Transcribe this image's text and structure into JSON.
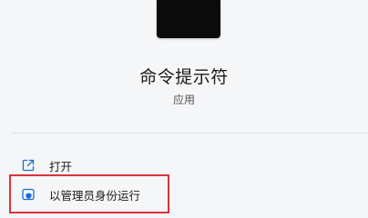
{
  "app": {
    "title": "命令提示符",
    "type": "应用"
  },
  "actions": [
    {
      "label": "打开",
      "icon": "open-external-icon"
    },
    {
      "label": "以管理员身份运行",
      "icon": "shield-admin-icon"
    }
  ],
  "colors": {
    "highlight": "#d9333b",
    "icon_blue": "#1a6dd6"
  }
}
